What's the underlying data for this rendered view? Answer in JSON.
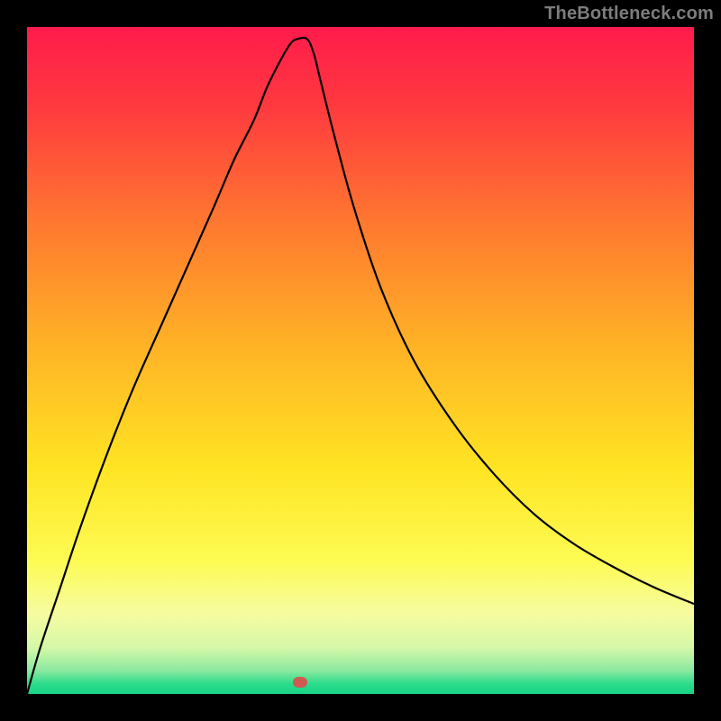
{
  "watermark": "TheBottleneck.com",
  "marker": {
    "x_pct": 41.0,
    "y_pct": 98.2,
    "color": "#cf5a52"
  },
  "chart_data": {
    "type": "line",
    "title": "",
    "xlabel": "",
    "ylabel": "",
    "x_range_pct": [
      0,
      100
    ],
    "y_range_pct": [
      0,
      100
    ],
    "ylim": [
      0,
      100
    ],
    "grid": false,
    "legend": false,
    "gradient_stops": [
      {
        "pos": 0.0,
        "color": "#ff1b4b"
      },
      {
        "pos": 0.12,
        "color": "#ff3a3f"
      },
      {
        "pos": 0.3,
        "color": "#ff7a2f"
      },
      {
        "pos": 0.48,
        "color": "#ffb326"
      },
      {
        "pos": 0.66,
        "color": "#ffe423"
      },
      {
        "pos": 0.8,
        "color": "#fdfb53"
      },
      {
        "pos": 0.88,
        "color": "#f6fca0"
      },
      {
        "pos": 0.93,
        "color": "#d6f8a8"
      },
      {
        "pos": 0.965,
        "color": "#8ae9a0"
      },
      {
        "pos": 0.985,
        "color": "#2bdc8b"
      },
      {
        "pos": 1.0,
        "color": "#17d384"
      }
    ],
    "series": [
      {
        "name": "curve",
        "stroke": "#000000",
        "stroke_width": 2.2,
        "x": [
          0,
          2,
          5,
          8,
          12,
          16,
          20,
          24,
          28,
          31,
          34,
          36,
          38,
          39.5,
          40.5,
          42,
          43,
          44,
          46,
          49,
          53,
          58,
          64,
          70,
          76,
          82,
          88,
          94,
          100
        ],
        "y": [
          0,
          7,
          16,
          25,
          36,
          46,
          55,
          64,
          73,
          80,
          86,
          91,
          95,
          97.5,
          98.2,
          98.2,
          96,
          92,
          84,
          73,
          61,
          50,
          40.5,
          33,
          27,
          22.5,
          19,
          16,
          13.5
        ]
      }
    ],
    "flat_segment": {
      "x_start_pct": 38.5,
      "x_end_pct": 42.5,
      "y_pct": 98.2
    }
  }
}
